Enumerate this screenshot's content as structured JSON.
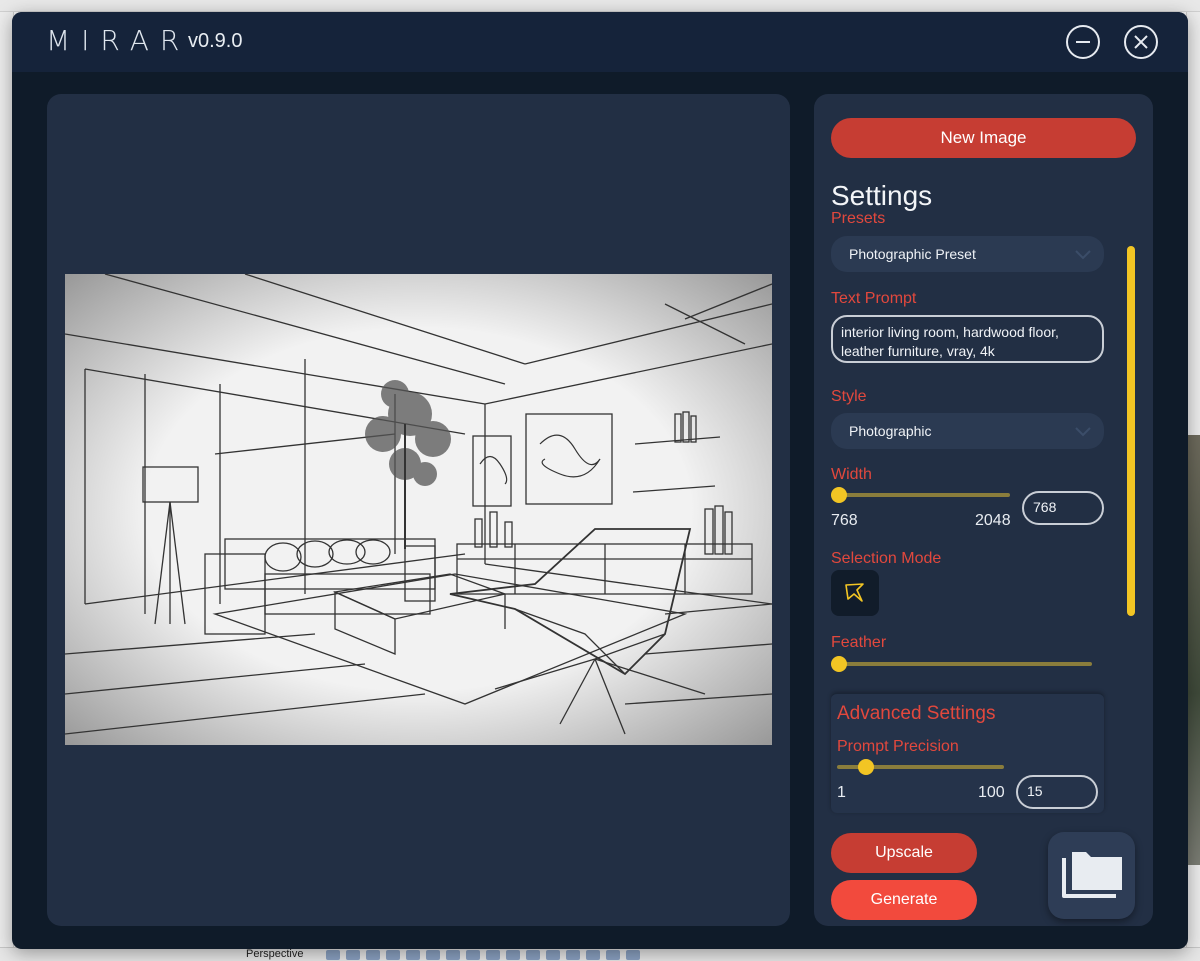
{
  "app": {
    "logo": "MIRAR",
    "version": "v0.9.0"
  },
  "host_app": {
    "status_view": "Perspective"
  },
  "settings": {
    "new_image_label": "New Image",
    "title": "Settings",
    "presets_label": "Presets",
    "preset_value": "Photographic Preset",
    "text_prompt_label": "Text Prompt",
    "text_prompt_value": "interior living room, hardwood floor, leather furniture, vray, 4k",
    "style_label": "Style",
    "style_value": "Photographic",
    "width_label": "Width",
    "width_min": "768",
    "width_max": "2048",
    "width_value": "768",
    "width_fraction": 0.0,
    "selection_mode_label": "Selection Mode",
    "feather_label": "Feather",
    "feather_fraction": 0.0,
    "advanced_title": "Advanced Settings",
    "prompt_precision_label": "Prompt Precision",
    "precision_min": "1",
    "precision_max": "100",
    "precision_value": "15",
    "precision_fraction": 0.14,
    "upscale_label": "Upscale",
    "generate_label": "Generate"
  },
  "colors": {
    "accent_red": "#c63d33",
    "generate_red": "#f24a3d",
    "label_red": "#e2483d",
    "slider_yellow": "#f2c524",
    "panel_bg": "#222f44",
    "window_bg": "#0f1b29"
  },
  "icons": {
    "minimize": "minimize-icon",
    "close": "close-icon",
    "dropdown": "chevron-down-icon",
    "selection": "lasso-selection-icon",
    "folder": "folder-icon"
  }
}
